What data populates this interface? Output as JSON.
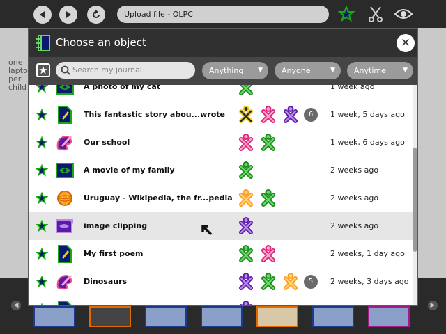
{
  "browser": {
    "url_title": "Upload file - OLPC",
    "page_side_text": "one laptop per child"
  },
  "dialog": {
    "title": "Choose an object",
    "search_placeholder": "Search my journal",
    "filters": [
      {
        "label": "Anything"
      },
      {
        "label": "Anyone"
      },
      {
        "label": "Anytime"
      }
    ]
  },
  "entries": [
    {
      "title": "A photo of my cat",
      "icon": "image-viewer-icon",
      "buddies": [
        "green"
      ],
      "count": "",
      "date": "1 week ago"
    },
    {
      "title": "This fantastic story abou...wrote",
      "icon": "write-document-icon",
      "buddies": [
        "yellow",
        "pink",
        "purple"
      ],
      "count": "6",
      "date": "1 week, 5 days ago"
    },
    {
      "title": "Our school",
      "icon": "paint-palette-icon",
      "buddies": [
        "pink",
        "green"
      ],
      "count": "",
      "date": "1 week, 6 days ago"
    },
    {
      "title": "A movie of my family",
      "icon": "video-player-icon",
      "buddies": [
        "green"
      ],
      "count": "",
      "date": "2 weeks ago"
    },
    {
      "title": "Uruguay - Wikipedia, the fr...pedia",
      "icon": "web-browser-icon",
      "buddies": [
        "orange",
        "green"
      ],
      "count": "",
      "date": "2 weeks ago"
    },
    {
      "title": "image clipping",
      "icon": "image-clipping-icon",
      "buddies": [
        "purple"
      ],
      "count": "",
      "date": "2 weeks ago"
    },
    {
      "title": "My first poem",
      "icon": "write-document-icon",
      "buddies": [
        "green",
        "pink"
      ],
      "count": "",
      "date": "2 weeks, 1 day ago"
    },
    {
      "title": "Dinosaurs",
      "icon": "paint-palette-icon",
      "buddies": [
        "purple",
        "green",
        "orange"
      ],
      "count": "5",
      "date": "2 weeks, 3 days ago"
    },
    {
      "title": "",
      "icon": "write-document-icon",
      "buddies": [
        "purple"
      ],
      "count": "",
      "date": ""
    }
  ],
  "colors": {
    "star_fill": "#0a1a6e",
    "star_stroke": "#1aa81a",
    "buddy_green": [
      "#1a8a1a",
      "#6ad66a"
    ],
    "buddy_pink": [
      "#e0207a",
      "#f7a6cc"
    ],
    "buddy_purple": [
      "#5a1aa8",
      "#b98ae6"
    ],
    "buddy_yellow": [
      "#f0d020",
      "#2a2a2a"
    ],
    "buddy_orange": [
      "#ff9c1a",
      "#ffd27a"
    ]
  }
}
